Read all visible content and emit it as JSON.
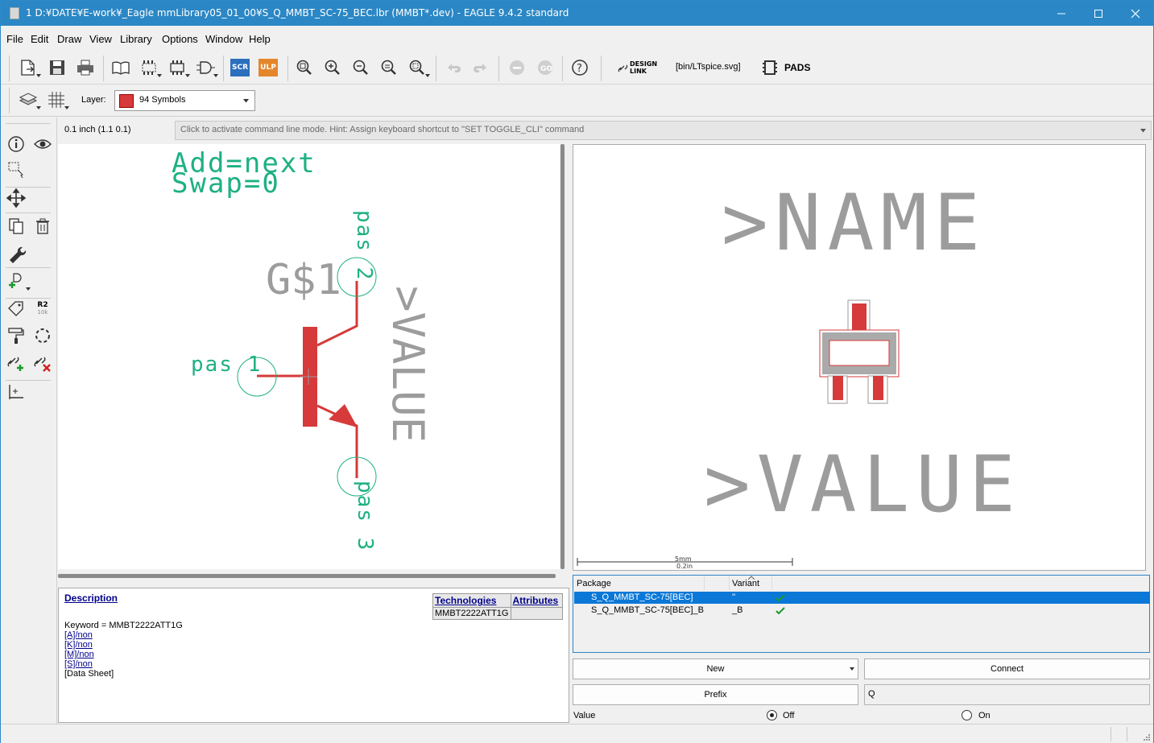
{
  "window": {
    "title": "1 D:¥DATE¥E-work¥_Eagle mmLibrary05_01_00¥S_Q_MMBT_SC-75_BEC.lbr (MMBT*.dev) - EAGLE 9.4.2 standard"
  },
  "menu": [
    "File",
    "Edit",
    "Draw",
    "View",
    "Library",
    "Options",
    "Window",
    "Help"
  ],
  "toolbar": {
    "scr_label": "SCR",
    "ulp_label": "ULP",
    "design_link_top": "DESIGN",
    "design_link_bottom": "LINK",
    "ltspice_label": "[bin/LTspice.svg]",
    "pads_label": "PADS"
  },
  "parambar": {
    "layer_label": "Layer:",
    "layer_value": "94 Symbols",
    "layer_color": "#d63a3a"
  },
  "lefttools": {
    "r2_top": "R2",
    "r2_bottom": "10k"
  },
  "coordinate": "0.1 inch (1.1 0.1)",
  "command_hint": "Click to activate command line mode. Hint: Assign keyboard shortcut to \"SET TOGGLE_CLI\" command",
  "symbol": {
    "addlevel": "Add=next",
    "swaplevel": "Swap=0",
    "gate_name": "G$1",
    "value_text": ">VALUE",
    "pin1": "pas 1",
    "pin2": "pas 2",
    "pin3": "pas 3",
    "pin_color": "#1eb083",
    "body_color": "#d63a3a"
  },
  "package_preview": {
    "name_text": ">NAME",
    "value_text": ">VALUE",
    "scale_mm": "5mm",
    "scale_in": "0.2in"
  },
  "description": {
    "title": "Description",
    "keyword": "Keyword = MMBT2222ATT1G",
    "links": [
      "[A]/non",
      "[K]/non",
      "[M]/non",
      "[S]/non"
    ],
    "datasheet": "[Data Sheet]",
    "tech_header": "Technologies",
    "attr_header": "Attributes",
    "tech_value": "MMBT2222ATT1G",
    "attr_value": ""
  },
  "packages": {
    "col_package": "Package",
    "col_variant": "Variant",
    "rows": [
      {
        "package": "S_Q_MMBT_SC-75[BEC]",
        "variant": "''",
        "selected": true
      },
      {
        "package": "S_Q_MMBT_SC-75[BEC]_B",
        "variant": "_B",
        "selected": false
      }
    ]
  },
  "buttons": {
    "new": "New",
    "connect": "Connect",
    "prefix": "Prefix",
    "prefix_value": "Q"
  },
  "value_option": {
    "label": "Value",
    "off": "Off",
    "on": "On",
    "selected": "Off"
  }
}
